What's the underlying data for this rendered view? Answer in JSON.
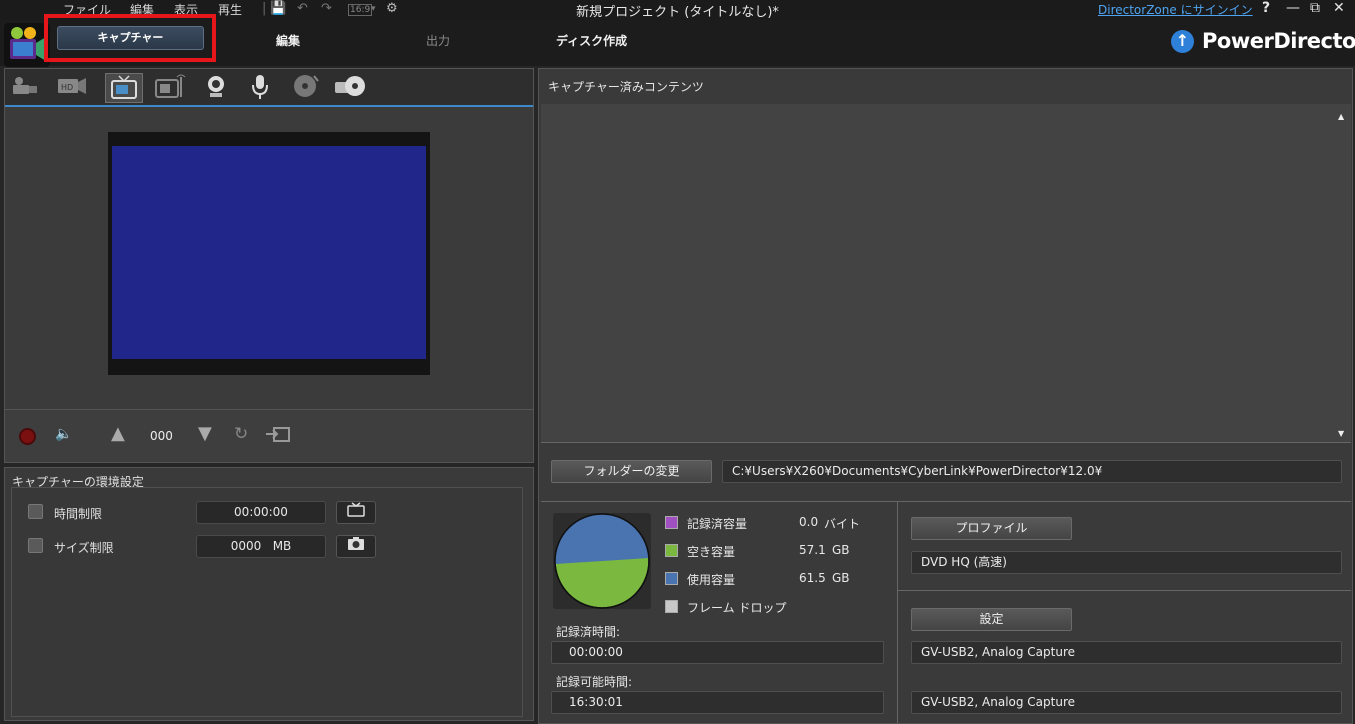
{
  "titlebar": {
    "menus": [
      "ファイル",
      "編集",
      "表示",
      "再生"
    ],
    "window_title": "新規プロジェクト (タイトルなし)*",
    "aspect_ratio": "16:9",
    "signin_link": "DirectorZone にサインイン",
    "help": "?",
    "minimize": "—",
    "restore": "⧉",
    "close": "✕"
  },
  "modes": {
    "capture": "キャプチャー",
    "edit": "編集",
    "output": "出力",
    "disc": "ディスク作成"
  },
  "brand": {
    "name": "PowerDirector",
    "accent": "#2f80d8"
  },
  "capture_sources": [
    "dv-camcorder-icon",
    "hdv-camcorder-icon",
    "tv-icon",
    "digital-tv-icon",
    "webcam-icon",
    "microphone-icon",
    "cd-icon",
    "dvd-icon"
  ],
  "controls": {
    "counter": "000"
  },
  "capture_settings": {
    "title": "キャプチャーの環境設定",
    "time_limit_label": "時間制限",
    "time_limit_value": "00:00:00",
    "size_limit_label": "サイズ制限",
    "size_limit_value": "0000",
    "size_limit_unit": "MB"
  },
  "captured": {
    "title": "キャプチャー済みコンテンツ",
    "change_folder": "フォルダーの変更",
    "folder_path": "C:¥Users¥X260¥Documents¥CyberLink¥PowerDirector¥12.0¥"
  },
  "storage": {
    "legend": [
      {
        "label": "記録済容量",
        "value": "0.0",
        "unit": "バイト",
        "color": "#a050c0"
      },
      {
        "label": "空き容量",
        "value": "57.1",
        "unit": "GB",
        "color": "#7ab840"
      },
      {
        "label": "使用容量",
        "value": "61.5",
        "unit": "GB",
        "color": "#4a74b0"
      },
      {
        "label": "フレーム ドロップ",
        "value": "",
        "unit": "",
        "color": "#c8c8c8"
      }
    ],
    "recorded_time_label": "記録済時間:",
    "recorded_time": "00:00:00",
    "available_time_label": "記録可能時間:",
    "available_time": "16:30:01"
  },
  "profile": {
    "profile_button": "プロファイル",
    "profile_value": "DVD HQ (高速)",
    "settings_button": "設定",
    "video_device": "GV-USB2, Analog Capture",
    "audio_device": "GV-USB2, Analog Capture"
  }
}
